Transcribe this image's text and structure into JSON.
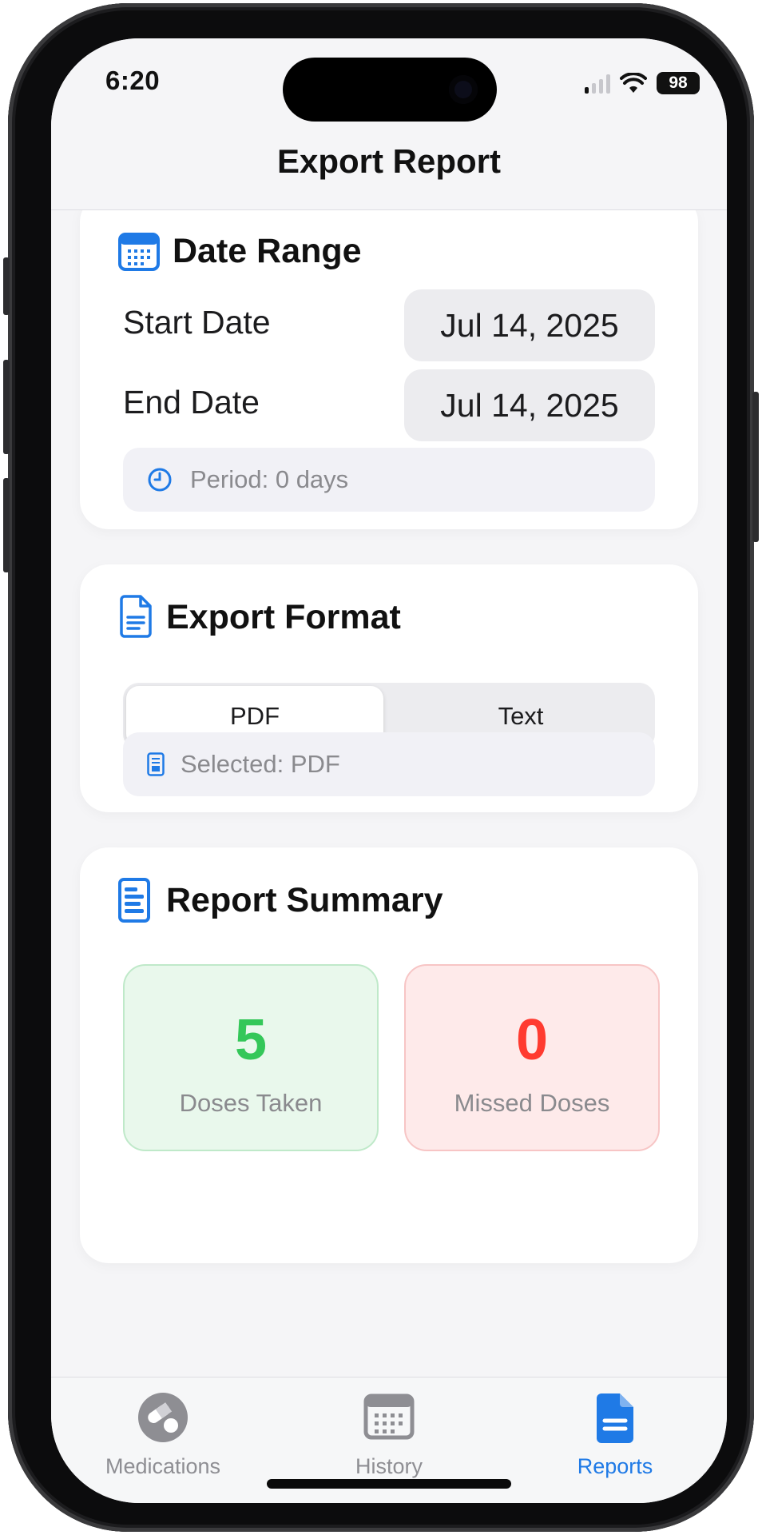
{
  "status_bar": {
    "time": "6:20",
    "battery": "98"
  },
  "nav": {
    "title": "Export Report"
  },
  "date_range": {
    "title": "Date Range",
    "start_label": "Start Date",
    "start_value": "Jul 14, 2025",
    "end_label": "End Date",
    "end_value": "Jul 14, 2025",
    "period_text": "Period: 0 days",
    "icon": "calendar-icon"
  },
  "export_format": {
    "title": "Export Format",
    "options": [
      "PDF",
      "Text"
    ],
    "selected_index": 0,
    "selected_text": "Selected: PDF",
    "icon": "document-icon"
  },
  "summary": {
    "title": "Report Summary",
    "taken_value": "5",
    "taken_label": "Doses Taken",
    "missed_value": "0",
    "missed_label": "Missed Doses",
    "icon": "report-icon"
  },
  "tabs": [
    {
      "label": "Medications",
      "icon": "pills-icon",
      "active": false
    },
    {
      "label": "History",
      "icon": "calendar-icon",
      "active": false
    },
    {
      "label": "Reports",
      "icon": "document-icon",
      "active": true
    }
  ],
  "colors": {
    "accent": "#1f7ae6",
    "taken": "#34c759",
    "missed": "#ff3b30"
  }
}
